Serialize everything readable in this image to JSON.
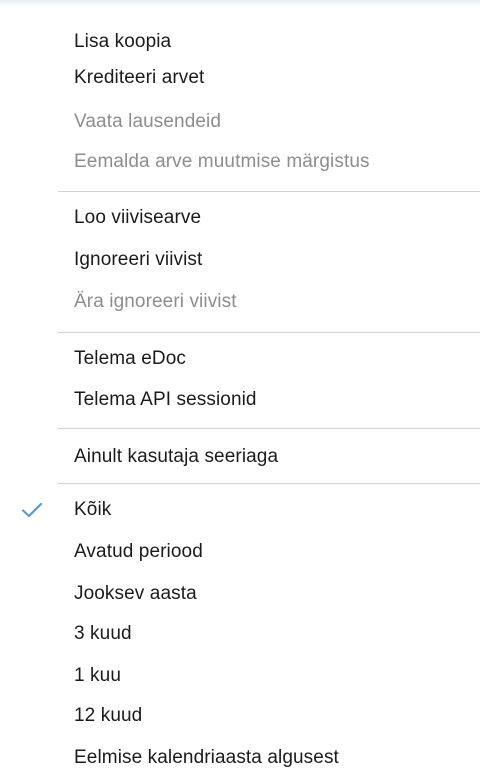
{
  "menu": {
    "groups": [
      {
        "items": [
          {
            "label": "Lisa koopia",
            "enabled": true
          },
          {
            "label": "Krediteeri arvet",
            "enabled": true
          },
          {
            "label": "Vaata lausendeid",
            "enabled": false
          },
          {
            "label": "Eemalda arve muutmise märgistus",
            "enabled": false
          }
        ]
      },
      {
        "items": [
          {
            "label": "Loo viivisearve",
            "enabled": true
          },
          {
            "label": "Ignoreeri viivist",
            "enabled": true
          },
          {
            "label": "Ära ignoreeri viivist",
            "enabled": false
          }
        ]
      },
      {
        "items": [
          {
            "label": "Telema eDoc",
            "enabled": true
          },
          {
            "label": "Telema API sessionid",
            "enabled": true
          }
        ]
      },
      {
        "items": [
          {
            "label": "Ainult kasutaja seeriaga",
            "enabled": true
          }
        ]
      },
      {
        "items": [
          {
            "label": "Kõik",
            "enabled": true,
            "checked": true
          },
          {
            "label": "Avatud periood",
            "enabled": true
          },
          {
            "label": "Jooksev aasta",
            "enabled": true
          },
          {
            "label": "3 kuud",
            "enabled": true
          },
          {
            "label": "1 kuu",
            "enabled": true
          },
          {
            "label": "12 kuud",
            "enabled": true
          },
          {
            "label": "Eelmise kalendriaasta algusest",
            "enabled": true
          }
        ]
      }
    ],
    "colors": {
      "text": "#1b1b1b",
      "disabled_text": "#8d8d8d",
      "separator": "#d2d2d2",
      "checkmark": "#5b9bd5",
      "background": "#ffffff"
    },
    "icons": {
      "checkmark": "checkmark-icon"
    }
  }
}
